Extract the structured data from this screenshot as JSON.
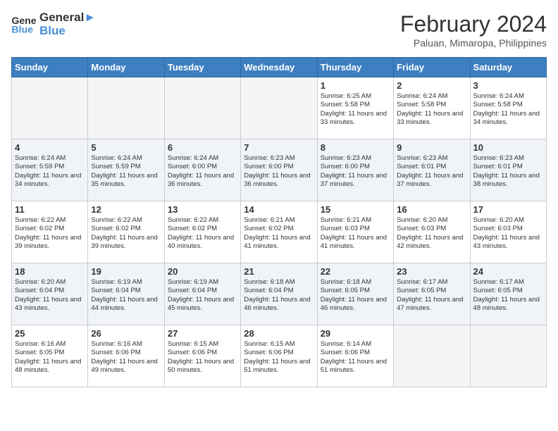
{
  "header": {
    "logo_line1": "General",
    "logo_line2": "Blue",
    "title": "February 2024",
    "subtitle": "Paluan, Mimaropa, Philippines"
  },
  "days_of_week": [
    "Sunday",
    "Monday",
    "Tuesday",
    "Wednesday",
    "Thursday",
    "Friday",
    "Saturday"
  ],
  "weeks": [
    [
      {
        "day": "",
        "info": ""
      },
      {
        "day": "",
        "info": ""
      },
      {
        "day": "",
        "info": ""
      },
      {
        "day": "",
        "info": ""
      },
      {
        "day": "1",
        "info": "Sunrise: 6:25 AM\nSunset: 5:58 PM\nDaylight: 11 hours and 33 minutes."
      },
      {
        "day": "2",
        "info": "Sunrise: 6:24 AM\nSunset: 5:58 PM\nDaylight: 11 hours and 33 minutes."
      },
      {
        "day": "3",
        "info": "Sunrise: 6:24 AM\nSunset: 5:58 PM\nDaylight: 11 hours and 34 minutes."
      }
    ],
    [
      {
        "day": "4",
        "info": "Sunrise: 6:24 AM\nSunset: 5:59 PM\nDaylight: 11 hours and 34 minutes."
      },
      {
        "day": "5",
        "info": "Sunrise: 6:24 AM\nSunset: 5:59 PM\nDaylight: 11 hours and 35 minutes."
      },
      {
        "day": "6",
        "info": "Sunrise: 6:24 AM\nSunset: 6:00 PM\nDaylight: 11 hours and 36 minutes."
      },
      {
        "day": "7",
        "info": "Sunrise: 6:23 AM\nSunset: 6:00 PM\nDaylight: 11 hours and 36 minutes."
      },
      {
        "day": "8",
        "info": "Sunrise: 6:23 AM\nSunset: 6:00 PM\nDaylight: 11 hours and 37 minutes."
      },
      {
        "day": "9",
        "info": "Sunrise: 6:23 AM\nSunset: 6:01 PM\nDaylight: 11 hours and 37 minutes."
      },
      {
        "day": "10",
        "info": "Sunrise: 6:23 AM\nSunset: 6:01 PM\nDaylight: 11 hours and 38 minutes."
      }
    ],
    [
      {
        "day": "11",
        "info": "Sunrise: 6:22 AM\nSunset: 6:02 PM\nDaylight: 11 hours and 39 minutes."
      },
      {
        "day": "12",
        "info": "Sunrise: 6:22 AM\nSunset: 6:02 PM\nDaylight: 11 hours and 39 minutes."
      },
      {
        "day": "13",
        "info": "Sunrise: 6:22 AM\nSunset: 6:02 PM\nDaylight: 11 hours and 40 minutes."
      },
      {
        "day": "14",
        "info": "Sunrise: 6:21 AM\nSunset: 6:02 PM\nDaylight: 11 hours and 41 minutes."
      },
      {
        "day": "15",
        "info": "Sunrise: 6:21 AM\nSunset: 6:03 PM\nDaylight: 11 hours and 41 minutes."
      },
      {
        "day": "16",
        "info": "Sunrise: 6:20 AM\nSunset: 6:03 PM\nDaylight: 11 hours and 42 minutes."
      },
      {
        "day": "17",
        "info": "Sunrise: 6:20 AM\nSunset: 6:03 PM\nDaylight: 11 hours and 43 minutes."
      }
    ],
    [
      {
        "day": "18",
        "info": "Sunrise: 6:20 AM\nSunset: 6:04 PM\nDaylight: 11 hours and 43 minutes."
      },
      {
        "day": "19",
        "info": "Sunrise: 6:19 AM\nSunset: 6:04 PM\nDaylight: 11 hours and 44 minutes."
      },
      {
        "day": "20",
        "info": "Sunrise: 6:19 AM\nSunset: 6:04 PM\nDaylight: 11 hours and 45 minutes."
      },
      {
        "day": "21",
        "info": "Sunrise: 6:18 AM\nSunset: 6:04 PM\nDaylight: 11 hours and 46 minutes."
      },
      {
        "day": "22",
        "info": "Sunrise: 6:18 AM\nSunset: 6:05 PM\nDaylight: 11 hours and 46 minutes."
      },
      {
        "day": "23",
        "info": "Sunrise: 6:17 AM\nSunset: 6:05 PM\nDaylight: 11 hours and 47 minutes."
      },
      {
        "day": "24",
        "info": "Sunrise: 6:17 AM\nSunset: 6:05 PM\nDaylight: 11 hours and 48 minutes."
      }
    ],
    [
      {
        "day": "25",
        "info": "Sunrise: 6:16 AM\nSunset: 6:05 PM\nDaylight: 11 hours and 48 minutes."
      },
      {
        "day": "26",
        "info": "Sunrise: 6:16 AM\nSunset: 6:06 PM\nDaylight: 11 hours and 49 minutes."
      },
      {
        "day": "27",
        "info": "Sunrise: 6:15 AM\nSunset: 6:06 PM\nDaylight: 11 hours and 50 minutes."
      },
      {
        "day": "28",
        "info": "Sunrise: 6:15 AM\nSunset: 6:06 PM\nDaylight: 11 hours and 51 minutes."
      },
      {
        "day": "29",
        "info": "Sunrise: 6:14 AM\nSunset: 6:06 PM\nDaylight: 11 hours and 51 minutes."
      },
      {
        "day": "",
        "info": ""
      },
      {
        "day": "",
        "info": ""
      }
    ]
  ]
}
